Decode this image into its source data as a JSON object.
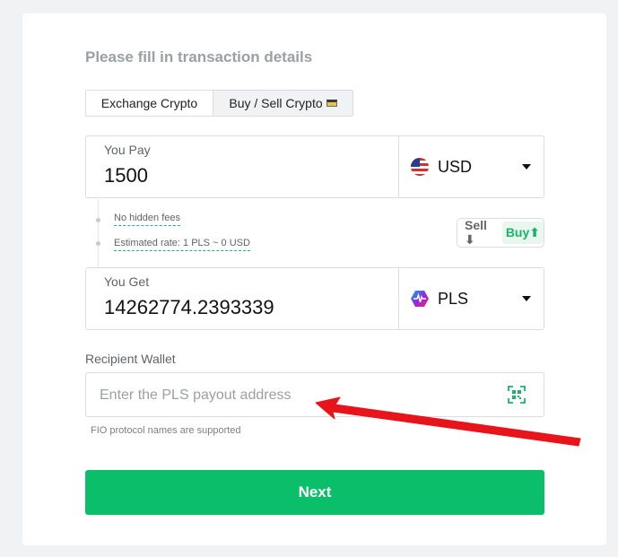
{
  "heading": "Please fill in transaction details",
  "tabs": [
    {
      "label": "Exchange Crypto",
      "active": true
    },
    {
      "label": "Buy / Sell Crypto",
      "active": false,
      "icon": "credit-card-icon"
    }
  ],
  "pay": {
    "label": "You Pay",
    "value": "1500",
    "currency": "USD",
    "currency_icon": "us-flag-icon"
  },
  "info": {
    "fees": "No hidden fees",
    "rate": "Estimated rate: 1 PLS ~ 0 USD"
  },
  "toggle": {
    "sell": "Sell",
    "sell_arrow": "⬇",
    "buy": "Buy",
    "buy_arrow": "⬆",
    "active": "Buy"
  },
  "get": {
    "label": "You Get",
    "value": "14262774.2393339",
    "currency": "PLS",
    "currency_icon": "pulsechain-logo-icon"
  },
  "wallet": {
    "label": "Recipient Wallet",
    "placeholder": "Enter the PLS payout address",
    "value": "",
    "hint": "FIO protocol names are supported"
  },
  "next_label": "Next",
  "colors": {
    "accent": "#0bbf6a",
    "annotation_arrow": "#e8141b"
  }
}
